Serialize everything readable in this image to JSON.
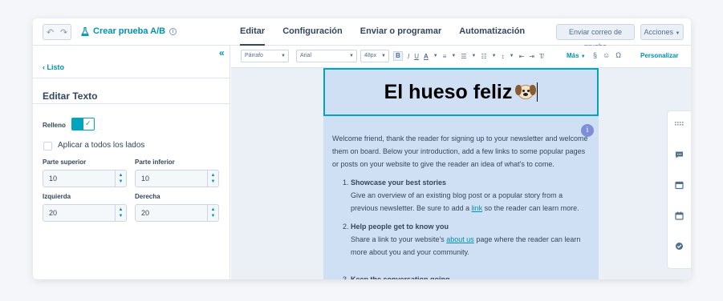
{
  "topbar": {
    "test_title": "Crear prueba A/B",
    "tabs": [
      {
        "label": "Editar",
        "active": true
      },
      {
        "label": "Configuración",
        "active": false
      },
      {
        "label": "Enviar o programar",
        "active": false
      },
      {
        "label": "Automatización",
        "active": false
      }
    ],
    "send_test_label": "Enviar correo de prueba",
    "actions_label": "Acciones"
  },
  "left_panel": {
    "back_label": "Listo",
    "title": "Editar Texto",
    "fill_label": "Relleno",
    "fill_enabled": true,
    "apply_all_label": "Aplicar a todos los lados",
    "apply_all_checked": false,
    "fields": {
      "top": {
        "label": "Parte superior",
        "value": "10"
      },
      "bottom": {
        "label": "Parte inferior",
        "value": "10"
      },
      "left": {
        "label": "Izquierda",
        "value": "20"
      },
      "right": {
        "label": "Derecha",
        "value": "20"
      }
    }
  },
  "toolbar": {
    "paragraph_style": "Párrafo",
    "font": "Arial",
    "font_size": "48px",
    "more_label": "Más",
    "customize_label": "Personalizar"
  },
  "email": {
    "heading": "El hueso feliz",
    "intro": "Welcome friend, thank the reader for signing up to your newsletter and welcome them on board. Below your introduction, add a few links to some popular pages or posts on your website to give the reader an idea of what's to come.",
    "items": [
      {
        "num": "1.",
        "title": "Showcase your best stories",
        "text_before": "Give an overview of an existing blog post or a popular story from a previous newsletter. Be sure to add a ",
        "link": "link",
        "text_after": " so the reader can learn more."
      },
      {
        "num": "2.",
        "title": "Help people get to know you",
        "text_before": "Share a link to your website's ",
        "link": "about us",
        "text_after": " page where the reader can learn more about you and your community."
      },
      {
        "num": "3.",
        "title": "Keep the conversation going"
      }
    ]
  },
  "icons": {
    "undo": "undo-icon",
    "redo": "redo-icon",
    "flask": "flask-icon",
    "info": "info-icon",
    "collapse": "collapse-icon",
    "grid": "grid-icon",
    "comment": "comment-icon",
    "browser": "browser-icon",
    "calendar": "calendar-icon",
    "check": "check-circle-icon"
  },
  "colors": {
    "accent": "#00a4bd",
    "link": "#0091ae",
    "email_bg": "#cfe0f4",
    "text": "#33475b"
  }
}
